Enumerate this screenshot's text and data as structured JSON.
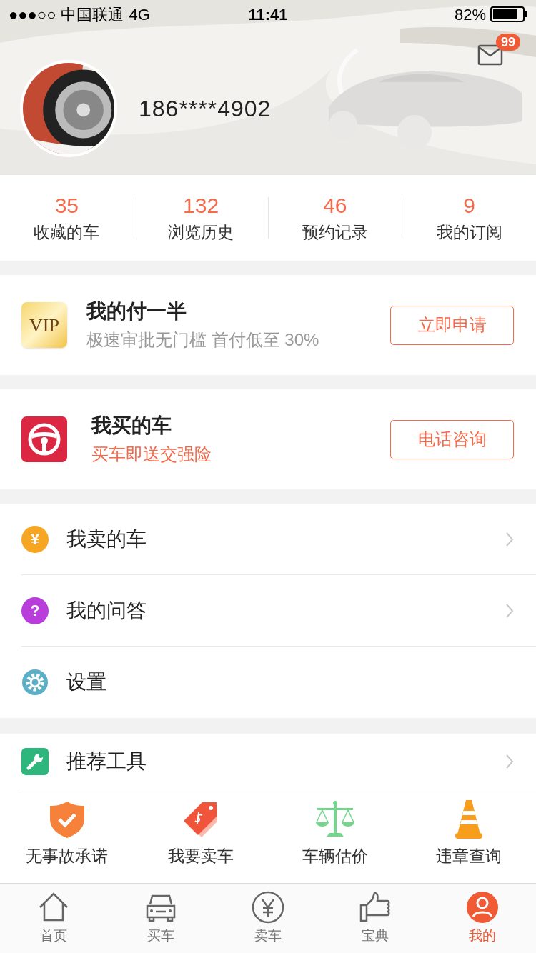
{
  "status_bar": {
    "carrier": "●●●○○ 中国联通",
    "network": "4G",
    "time": "11:41",
    "battery": "82%"
  },
  "profile": {
    "phone": "186****4902",
    "message_badge": "99"
  },
  "stats": [
    {
      "value": "35",
      "label": "收藏的车"
    },
    {
      "value": "132",
      "label": "浏览历史"
    },
    {
      "value": "46",
      "label": "预约记录"
    },
    {
      "value": "9",
      "label": "我的订阅"
    }
  ],
  "promos": [
    {
      "kind": "vip",
      "icon_text": "VIP",
      "title": "我的付一半",
      "subtitle": "极速审批无门槛 首付低至 30%",
      "subtitle_highlight": false,
      "button": "立即申请"
    },
    {
      "kind": "wheel",
      "title": "我买的车",
      "subtitle": "买车即送交强险",
      "subtitle_highlight": true,
      "button": "电话咨询"
    }
  ],
  "menu": [
    {
      "kind": "yuan",
      "icon_text": "¥",
      "label": "我卖的车",
      "chevron": true,
      "color": "#f6a623"
    },
    {
      "kind": "question",
      "icon_text": "?",
      "label": "我的问答",
      "chevron": true,
      "color": "#b83ddb"
    },
    {
      "kind": "gear",
      "label": "设置",
      "chevron": false,
      "color": "#5bb0c8"
    }
  ],
  "tools": {
    "title": "推荐工具",
    "items": [
      {
        "kind": "shield",
        "label": "无事故承诺"
      },
      {
        "kind": "tag",
        "label": "我要卖车"
      },
      {
        "kind": "scale",
        "label": "车辆估价"
      },
      {
        "kind": "cone",
        "label": "违章查询"
      }
    ]
  },
  "tab_bar": [
    {
      "kind": "home",
      "label": "首页",
      "selected": false
    },
    {
      "kind": "car",
      "label": "买车",
      "selected": false
    },
    {
      "kind": "yuan",
      "label": "卖车",
      "selected": false
    },
    {
      "kind": "thumb",
      "label": "宝典",
      "selected": false
    },
    {
      "kind": "user",
      "label": "我的",
      "selected": true
    }
  ]
}
